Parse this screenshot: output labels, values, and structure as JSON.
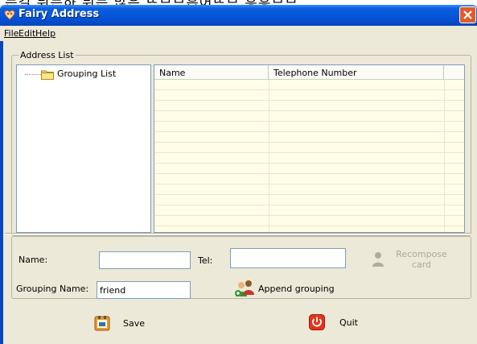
{
  "top_strip": {
    "text": "는걸 뒤는하 뒤는 많은 뜨므므흡어뜨므 흥흥므므"
  },
  "window": {
    "title": "Fairy Address",
    "close_label": "✕"
  },
  "menu": {
    "file": "File",
    "edit": "Edit",
    "help": "Help"
  },
  "address_list": {
    "group_label": "Address List",
    "tree_root": "Grouping List",
    "columns": [
      "Name",
      "Telephone Number"
    ]
  },
  "form": {
    "name_label": "Name:",
    "name_value": "",
    "tel_label": "Tel:",
    "tel_value": "",
    "recompose_label": "Recompose card",
    "grouping_label": "Grouping Name:",
    "grouping_value": "friend",
    "append_label": "Append grouping"
  },
  "actions": {
    "save": "Save",
    "quit": "Quit"
  },
  "colors": {
    "titlebar": "#0554d8",
    "window_bg": "#ece9d8",
    "list_bg": "#fffde8",
    "close": "#e35a2b"
  }
}
